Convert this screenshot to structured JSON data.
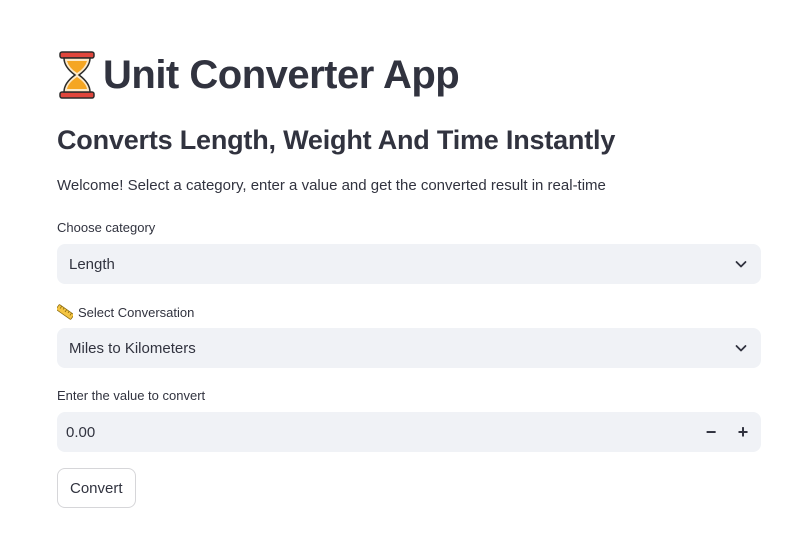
{
  "header": {
    "title_icon": "hourglass-icon",
    "title": "Unit Converter App",
    "subtitle": "Converts Length, Weight And Time Instantly",
    "welcome": "Welcome! Select a category, enter a value and get the converted result in real-time"
  },
  "category": {
    "label": "Choose category",
    "selected": "Length"
  },
  "conversion": {
    "label_icon": "ruler-icon",
    "label": "Select Conversation",
    "selected": "Miles to Kilometers"
  },
  "value": {
    "label": "Enter the value to convert",
    "current": "0.00",
    "decrement": "−",
    "increment": "+"
  },
  "actions": {
    "convert_label": "Convert"
  },
  "colors": {
    "text": "#31333f",
    "field_bg": "#f0f2f6",
    "button_border": "#d6d6d9"
  }
}
